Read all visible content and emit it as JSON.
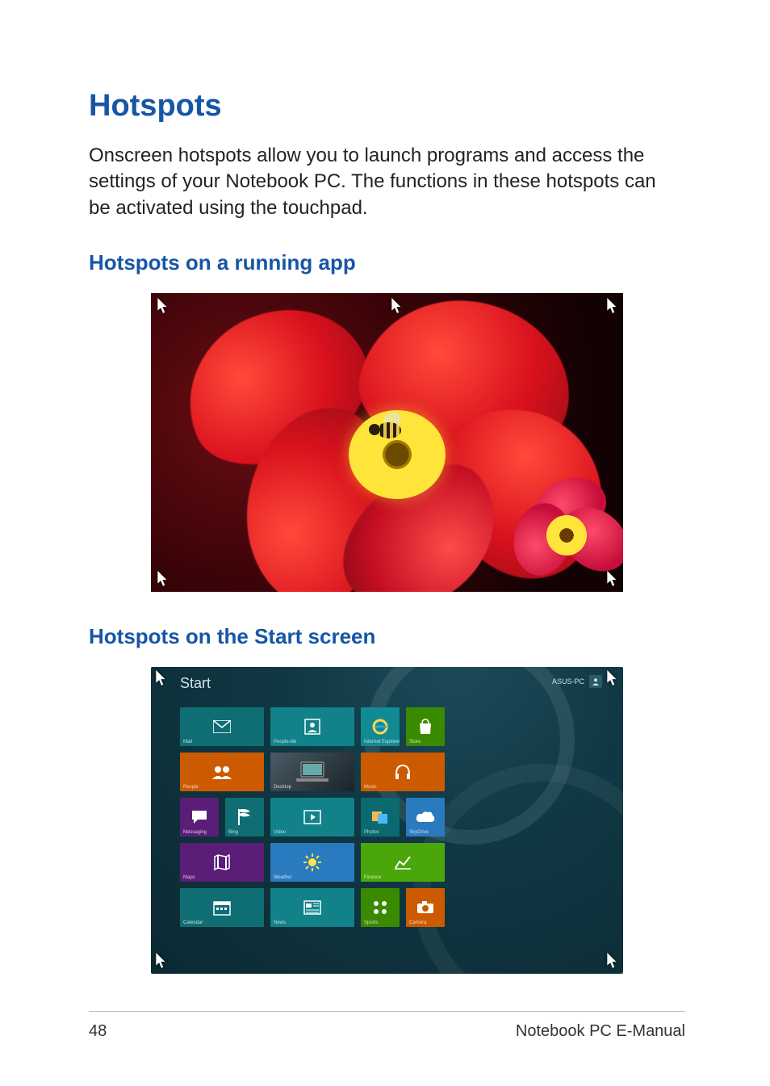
{
  "headings": {
    "title": "Hotspots",
    "sub1": "Hotspots on a running app",
    "sub2": "Hotspots on the Start screen"
  },
  "paragraph": "Onscreen hotspots allow you to launch programs and access the settings of your Notebook PC. The functions in these hotspots can be activated using the touchpad.",
  "figure1": {
    "alt": "Photo of a bee on a red flower shown full-screen with five mouse-cursor hotspots in the corners and top center",
    "hotspots": [
      "top-left",
      "top-center",
      "top-right",
      "bottom-left",
      "bottom-right"
    ]
  },
  "figure2": {
    "start_label": "Start",
    "user_label": "ASUS-PC",
    "hotspots": [
      "top-left",
      "top-right",
      "bottom-left",
      "bottom-right"
    ],
    "tiles": [
      {
        "name": "Mail",
        "icon": "mail",
        "color": "teal",
        "w": 2
      },
      {
        "name": "People-tile",
        "icon": "contact",
        "color": "teal2",
        "w": 2
      },
      {
        "name": "Internet Explorer",
        "icon": "ie",
        "color": "cyan",
        "w": 1
      },
      {
        "name": "Store",
        "icon": "bag",
        "color": "green",
        "w": 1
      },
      {
        "name": "People",
        "icon": "people",
        "color": "orange",
        "w": 2
      },
      {
        "name": "Desktop",
        "icon": "desktop",
        "color": "grad",
        "w": 2
      },
      {
        "name": "Music",
        "icon": "headphones",
        "color": "orange",
        "w": 2
      },
      {
        "name": "Messaging",
        "icon": "chat",
        "color": "purple",
        "w": 1
      },
      {
        "name": "Bing",
        "icon": "flag",
        "color": "teal",
        "w": 1
      },
      {
        "name": "Video",
        "icon": "play",
        "color": "teal2",
        "w": 2
      },
      {
        "name": "Photos",
        "icon": "photos",
        "color": "darkcyan",
        "w": 1
      },
      {
        "name": "SkyDrive",
        "icon": "cloud",
        "color": "blue2",
        "w": 1
      },
      {
        "name": "Maps",
        "icon": "map",
        "color": "purple",
        "w": 2
      },
      {
        "name": "Weather",
        "icon": "sun",
        "color": "blue2",
        "w": 2
      },
      {
        "name": "Finance",
        "icon": "chart",
        "color": "green2",
        "w": 2
      },
      {
        "name": "Calendar",
        "icon": "calendar",
        "color": "teal",
        "w": 2
      },
      {
        "name": "News",
        "icon": "news",
        "color": "teal2",
        "w": 2
      },
      {
        "name": "Sports",
        "icon": "sports",
        "color": "green",
        "w": 1
      },
      {
        "name": "Camera",
        "icon": "camera",
        "color": "orange",
        "w": 1
      }
    ]
  },
  "footer": {
    "page": "48",
    "book": "Notebook PC E-Manual"
  }
}
